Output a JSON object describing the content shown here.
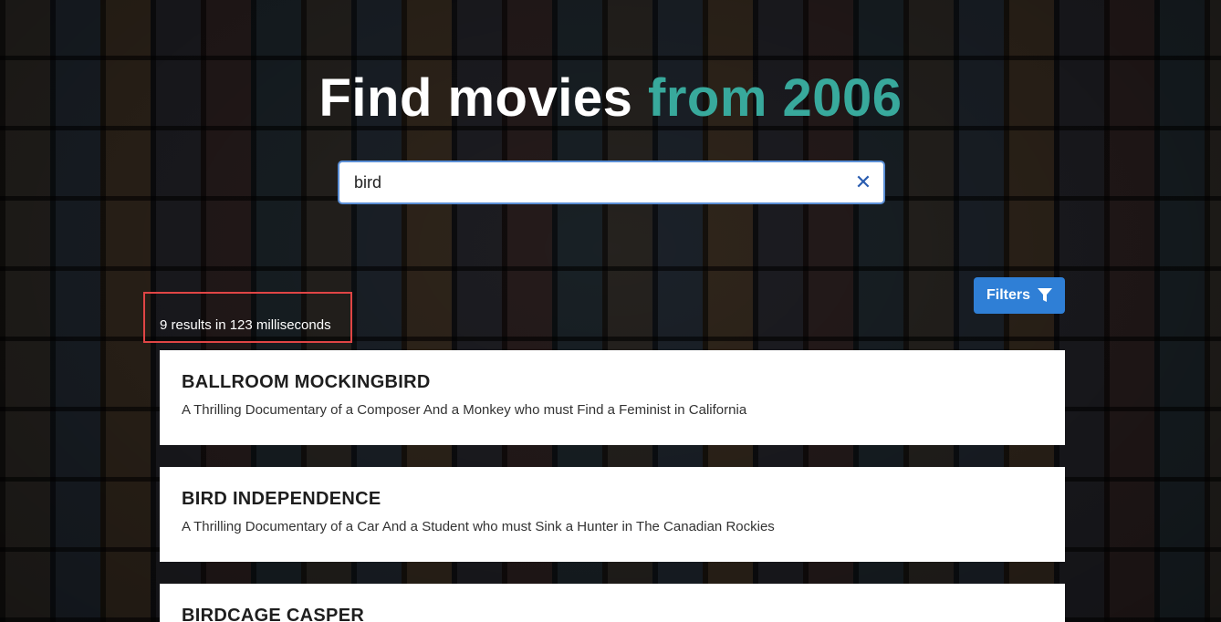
{
  "header": {
    "title_main": "Find movies",
    "title_accent": "from 2006"
  },
  "search": {
    "value": "bird",
    "clear_icon": "close-icon"
  },
  "filters": {
    "label": "Filters",
    "icon": "filter-icon"
  },
  "results": {
    "summary": "9 results in 123 milliseconds",
    "items": [
      {
        "title": "BALLROOM MOCKINGBIRD",
        "description": "A Thrilling Documentary of a Composer And a Monkey who must Find a Feminist in California"
      },
      {
        "title": "BIRD INDEPENDENCE",
        "description": "A Thrilling Documentary of a Car And a Student who must Sink a Hunter in The Canadian Rockies"
      },
      {
        "title": "BIRDCAGE CASPER",
        "description": ""
      }
    ]
  },
  "colors": {
    "accent": "#38a99c",
    "button": "#2f7fd6",
    "highlight_border": "#e04545",
    "search_border": "#5b8fd6"
  }
}
